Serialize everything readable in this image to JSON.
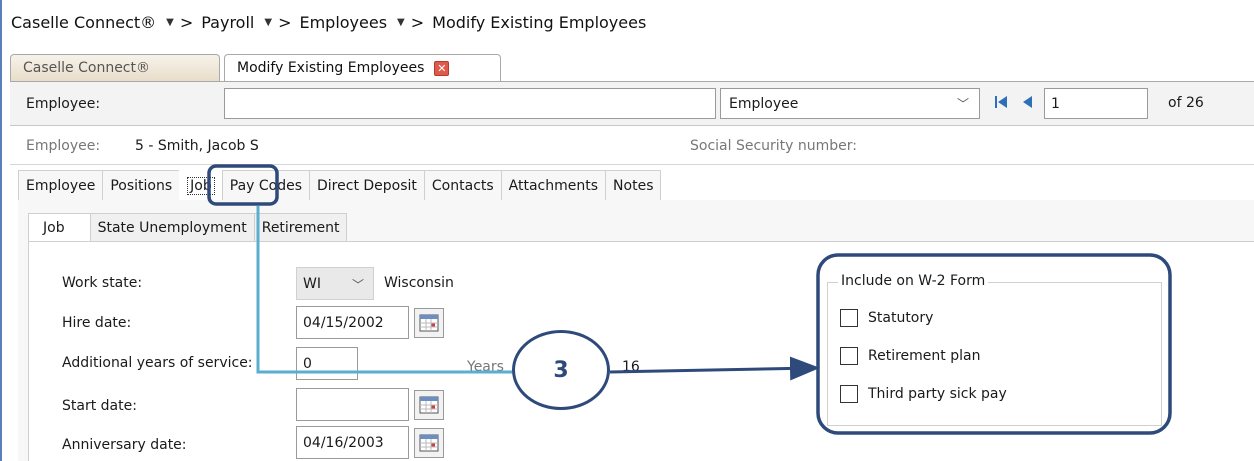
{
  "breadcrumb": {
    "items": [
      "Caselle Connect®",
      "Payroll",
      "Employees"
    ],
    "current": "Modify Existing Employees",
    "separator": ">"
  },
  "doc_tabs": [
    {
      "label": "Caselle Connect®",
      "active": false
    },
    {
      "label": "Modify Existing Employees",
      "active": true
    }
  ],
  "lookup": {
    "label": "Employee:",
    "input_value": "",
    "search_by": "Employee",
    "page": "1",
    "page_total": "of 26"
  },
  "employee_header": {
    "label": "Employee:",
    "value": "5 - Smith, Jacob S",
    "ssn_label": "Social Security number:"
  },
  "main_tabs": [
    {
      "label": "Employee"
    },
    {
      "label": "Positions"
    },
    {
      "label": "Job",
      "active": true
    },
    {
      "label": "Pay Codes"
    },
    {
      "label": "Direct Deposit"
    },
    {
      "label": "Contacts"
    },
    {
      "label": "Attachments"
    },
    {
      "label": "Notes"
    }
  ],
  "sub_tabs": [
    {
      "label": "Job",
      "active": true
    },
    {
      "label": "State Unemployment"
    },
    {
      "label": "Retirement"
    }
  ],
  "job_form": {
    "work_state_label": "Work state:",
    "work_state_code": "WI",
    "work_state_name": "Wisconsin",
    "hire_date_label": "Hire date:",
    "hire_date": "04/15/2002",
    "additional_years_label": "Additional years of service:",
    "additional_years": "0",
    "years_label": "Years",
    "years_value": "16",
    "start_date_label": "Start date:",
    "start_date": "",
    "anniversary_date_label": "Anniversary date:",
    "anniversary_date": "04/16/2003"
  },
  "w2_group": {
    "legend": "Include on W-2 Form",
    "options": [
      {
        "label": "Statutory",
        "checked": false
      },
      {
        "label": "Retirement plan",
        "checked": false
      },
      {
        "label": "Third party sick pay",
        "checked": false
      }
    ]
  },
  "callout": {
    "number": "3"
  },
  "colors": {
    "callout_dark": "#2e4a7a",
    "callout_light": "#5aaed0",
    "close_red": "#e05a4a"
  }
}
